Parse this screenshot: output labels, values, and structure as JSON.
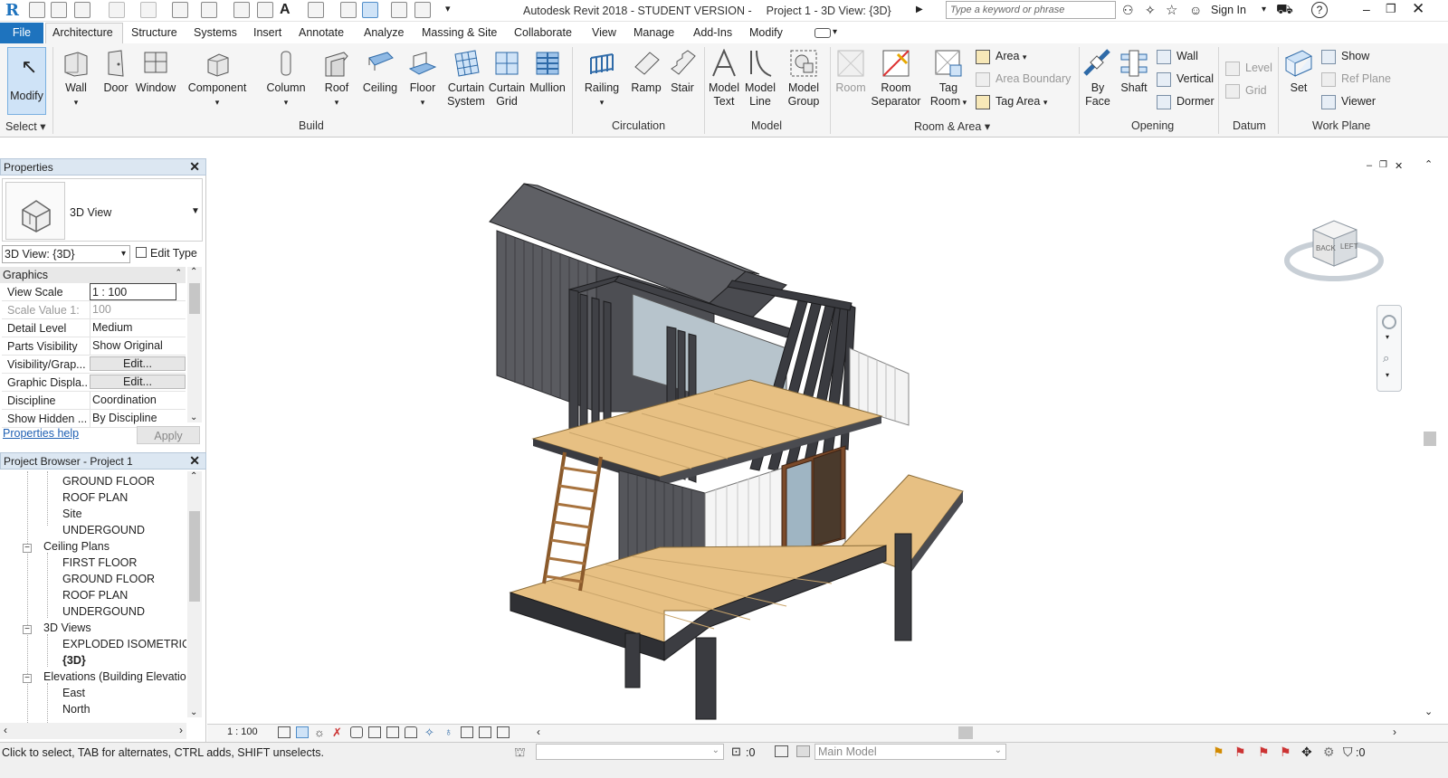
{
  "titlebar": {
    "app_title": "Autodesk Revit 2018 - STUDENT VERSION -",
    "doc_title": "Project 1 - 3D View: {3D}",
    "search_placeholder": "Type a keyword or phrase",
    "sign_in": "Sign In"
  },
  "menubar": {
    "file": "File",
    "tabs": [
      "Architecture",
      "Structure",
      "Systems",
      "Insert",
      "Annotate",
      "Analyze",
      "Massing & Site",
      "Collaborate",
      "View",
      "Manage",
      "Add-Ins",
      "Modify"
    ]
  },
  "ribbon": {
    "modify": "Modify",
    "select": "Select",
    "build": {
      "title": "Build",
      "wall": "Wall",
      "door": "Door",
      "window": "Window",
      "component": "Component",
      "column": "Column",
      "roof": "Roof",
      "ceiling": "Ceiling",
      "floor": "Floor",
      "curtain_system": [
        "Curtain",
        "System"
      ],
      "curtain_grid": [
        "Curtain",
        "Grid"
      ],
      "mullion": "Mullion"
    },
    "circulation": {
      "title": "Circulation",
      "railing": "Railing",
      "ramp": "Ramp",
      "stair": "Stair"
    },
    "model": {
      "title": "Model",
      "model_text": [
        "Model",
        "Text"
      ],
      "model_line": [
        "Model",
        "Line"
      ],
      "model_group": [
        "Model",
        "Group"
      ]
    },
    "room_area": {
      "title": "Room & Area",
      "room": "Room",
      "room_separator": [
        "Room",
        "Separator"
      ],
      "tag_room": [
        "Tag",
        "Room"
      ],
      "area": "Area",
      "area_boundary": "Area  Boundary",
      "tag_area": "Tag  Area"
    },
    "opening": {
      "title": "Opening",
      "by_face": [
        "By",
        "Face"
      ],
      "shaft": "Shaft",
      "wall": "Wall",
      "vertical": "Vertical",
      "dormer": "Dormer"
    },
    "datum": {
      "title": "Datum",
      "level": "Level",
      "grid": "Grid"
    },
    "work_plane": {
      "title": "Work Plane",
      "set": "Set",
      "show": "Show",
      "ref_plane": "Ref  Plane",
      "viewer": "Viewer"
    }
  },
  "properties": {
    "title": "Properties",
    "type_name": "3D View",
    "instance_selector": "3D View: {3D}",
    "edit_type": "Edit Type",
    "group": "Graphics",
    "rows": [
      {
        "k": "View Scale",
        "v": "1 : 100"
      },
      {
        "k": "Scale Value    1:",
        "v": "100"
      },
      {
        "k": "Detail Level",
        "v": "Medium"
      },
      {
        "k": "Parts Visibility",
        "v": "Show Original"
      },
      {
        "k": "Visibility/Grap...",
        "v": "Edit..."
      },
      {
        "k": "Graphic Displa...",
        "v": "Edit..."
      },
      {
        "k": "Discipline",
        "v": "Coordination"
      },
      {
        "k": "Show Hidden ...",
        "v": "By Discipline"
      }
    ],
    "help": "Properties help",
    "apply": "Apply"
  },
  "browser": {
    "title": "Project Browser - Project 1",
    "items": [
      {
        "label": "GROUND FLOOR",
        "level": 2
      },
      {
        "label": "ROOF PLAN",
        "level": 2
      },
      {
        "label": "Site",
        "level": 2
      },
      {
        "label": "UNDERGOUND",
        "level": 2
      },
      {
        "label": "Ceiling Plans",
        "level": 1
      },
      {
        "label": "FIRST FLOOR",
        "level": 2
      },
      {
        "label": "GROUND FLOOR",
        "level": 2
      },
      {
        "label": "ROOF PLAN",
        "level": 2
      },
      {
        "label": "UNDERGOUND",
        "level": 2
      },
      {
        "label": "3D Views",
        "level": 1
      },
      {
        "label": "EXPLODED ISOMETRIC",
        "level": 2
      },
      {
        "label": "{3D}",
        "level": 2
      },
      {
        "label": "Elevations (Building Elevation",
        "level": 1
      },
      {
        "label": "East",
        "level": 2
      },
      {
        "label": "North",
        "level": 2
      }
    ]
  },
  "viewcube": {
    "back": "BACK",
    "left": "LEFT"
  },
  "viewbar": {
    "scale": "1 : 100"
  },
  "status": {
    "hint": "Click to select, TAB for alternates, CTRL adds, SHIFT unselects.",
    "selection_count": ":0",
    "model": "Main Model",
    "filter_count": ":0"
  },
  "colors": {
    "accent": "#1e73be",
    "wood": "#e7c083",
    "metal": "#4a4a4e",
    "ribbon_bg": "#f5f5f5"
  }
}
